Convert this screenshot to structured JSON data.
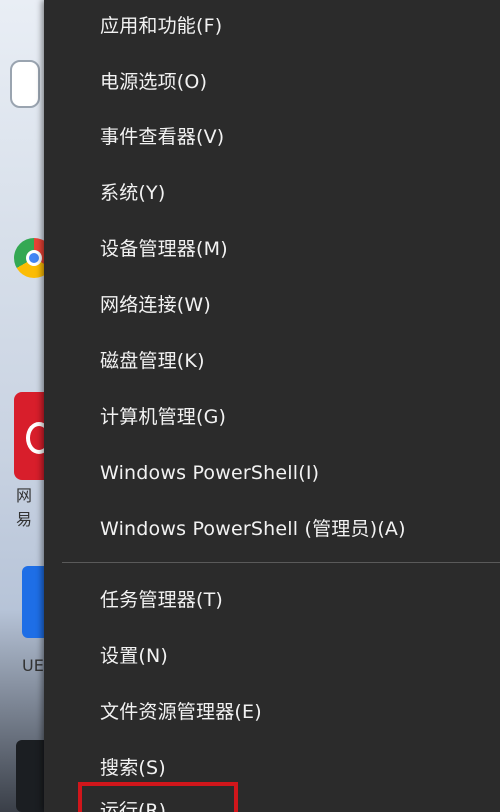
{
  "desktop": {
    "label_netease": "网易",
    "label_ue": "UE"
  },
  "menu": {
    "items_top": [
      "应用和功能(F)",
      "电源选项(O)",
      "事件查看器(V)",
      "系统(Y)",
      "设备管理器(M)",
      "网络连接(W)",
      "磁盘管理(K)",
      "计算机管理(G)",
      "Windows PowerShell(I)",
      "Windows PowerShell (管理员)(A)"
    ],
    "items_bottom": [
      "任务管理器(T)",
      "设置(N)",
      "文件资源管理器(E)",
      "搜索(S)"
    ],
    "partial_item": "运行(R)"
  },
  "colors": {
    "menu_bg": "#2b2b2b",
    "menu_text": "#f2f2f2",
    "separator": "#5a5a5a",
    "highlight": "#d0161b"
  }
}
